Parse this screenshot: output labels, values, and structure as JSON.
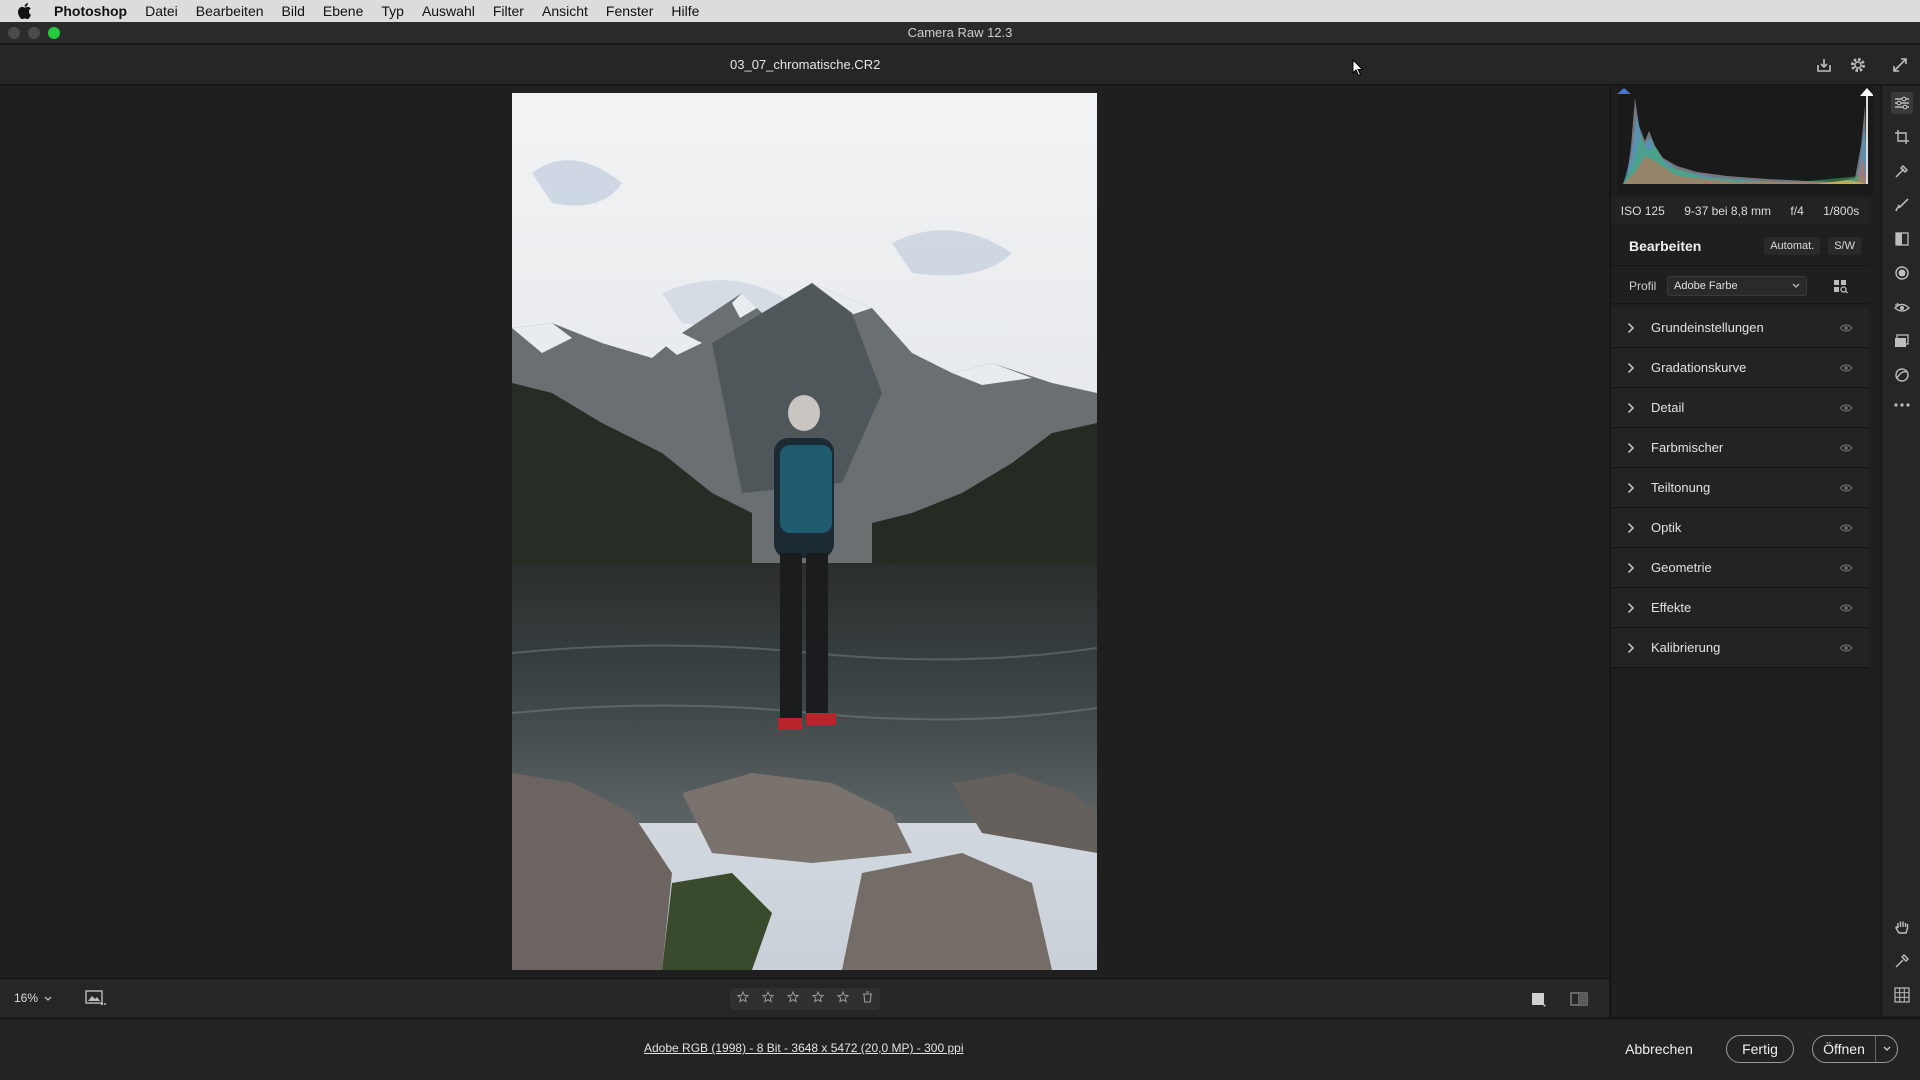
{
  "menubar": {
    "app": "Photoshop",
    "items": [
      "Datei",
      "Bearbeiten",
      "Bild",
      "Ebene",
      "Typ",
      "Auswahl",
      "Filter",
      "Ansicht",
      "Fenster",
      "Hilfe"
    ]
  },
  "window": {
    "title": "Camera Raw 12.3"
  },
  "file": {
    "name": "03_07_chromatische.CR2"
  },
  "exif": {
    "iso": "ISO 125",
    "lens": "9-37 bei 8,8 mm",
    "aperture": "f/4",
    "shutter": "1/800s"
  },
  "edit": {
    "title": "Bearbeiten",
    "auto_label": "Automat.",
    "bw_label": "S/W"
  },
  "profile": {
    "label": "Profil",
    "value": "Adobe Farbe"
  },
  "sections": [
    {
      "name": "Grundeinstellungen"
    },
    {
      "name": "Gradationskurve"
    },
    {
      "name": "Detail"
    },
    {
      "name": "Farbmischer"
    },
    {
      "name": "Teiltonung"
    },
    {
      "name": "Optik"
    },
    {
      "name": "Geometrie"
    },
    {
      "name": "Effekte"
    },
    {
      "name": "Kalibrierung"
    }
  ],
  "zoom": {
    "value": "16%"
  },
  "fileinfo": {
    "text": "Adobe RGB (1998) - 8 Bit - 3648 x 5472 (20,0 MP) - 300 ppi"
  },
  "footer": {
    "cancel": "Abbrechen",
    "done": "Fertig",
    "open": "Öffnen"
  },
  "colors": {
    "accent_green": "#27c93f",
    "panel": "#1f1f1f"
  }
}
